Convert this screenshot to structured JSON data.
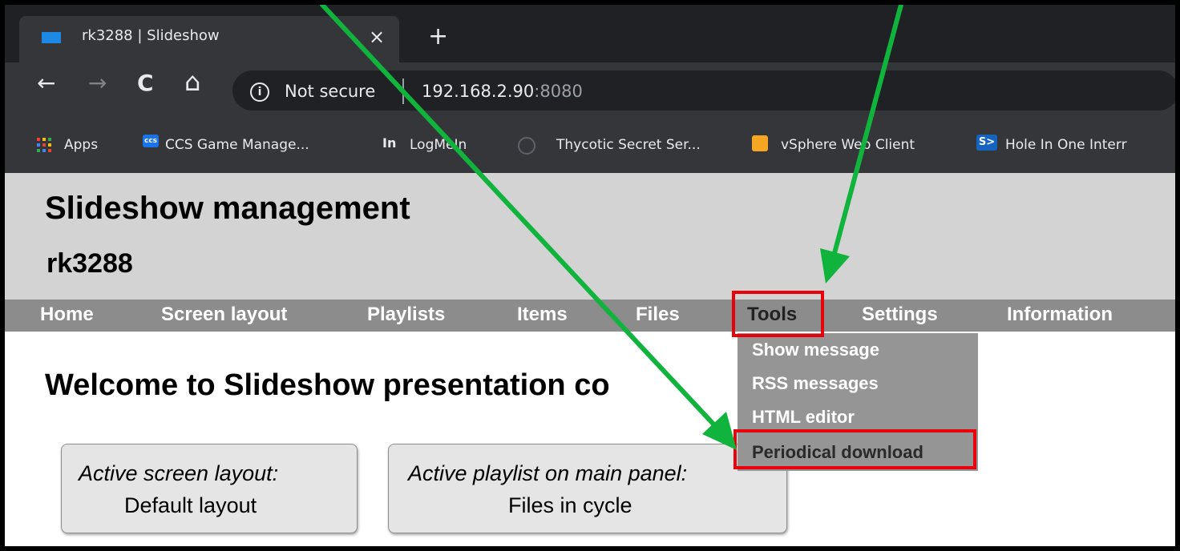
{
  "browser": {
    "tab_title": "rk3288 | Slideshow",
    "tab_close": "×",
    "new_tab": "+",
    "nav": {
      "back": "←",
      "forward": "→",
      "reload": "C",
      "home": "⌂"
    },
    "security_label": "Not secure",
    "url_host": "192.168.2.90",
    "url_port": ":8080",
    "bookmarks": [
      {
        "icon": "apps-grid-icon",
        "label": "Apps"
      },
      {
        "icon": "ccs-icon",
        "glyph": "ccs",
        "label": "CCS Game Manage..."
      },
      {
        "icon": "logmein-icon",
        "glyph": "In",
        "label": "LogMeIn"
      },
      {
        "icon": "thycotic-icon",
        "glyph": "",
        "label": "Thycotic Secret Ser..."
      },
      {
        "icon": "vsphere-icon",
        "glyph": "",
        "label": "vSphere Web Client"
      },
      {
        "icon": "holeinone-icon",
        "glyph": "S>",
        "label": "Hole In One Interr"
      }
    ]
  },
  "page": {
    "title": "Slideshow management",
    "subtitle": "rk3288",
    "menu": [
      "Home",
      "Screen layout",
      "Playlists",
      "Items",
      "Files",
      "Tools",
      "Settings",
      "Information"
    ],
    "active_menu": "Tools",
    "tools_dropdown": [
      "Show message",
      "RSS messages",
      "HTML editor",
      "Periodical download"
    ],
    "welcome": "Welcome to Slideshow presentation co",
    "cards": [
      {
        "label": "Active screen layout:",
        "value": "Default layout"
      },
      {
        "label": "Active playlist on main panel:",
        "value": "Files in cycle"
      }
    ]
  },
  "colors": {
    "annotation_arrow": "#10b33c",
    "highlight_box": "#e8000b",
    "chrome_dark": "#202124",
    "chrome_toolbar": "#35363a"
  }
}
